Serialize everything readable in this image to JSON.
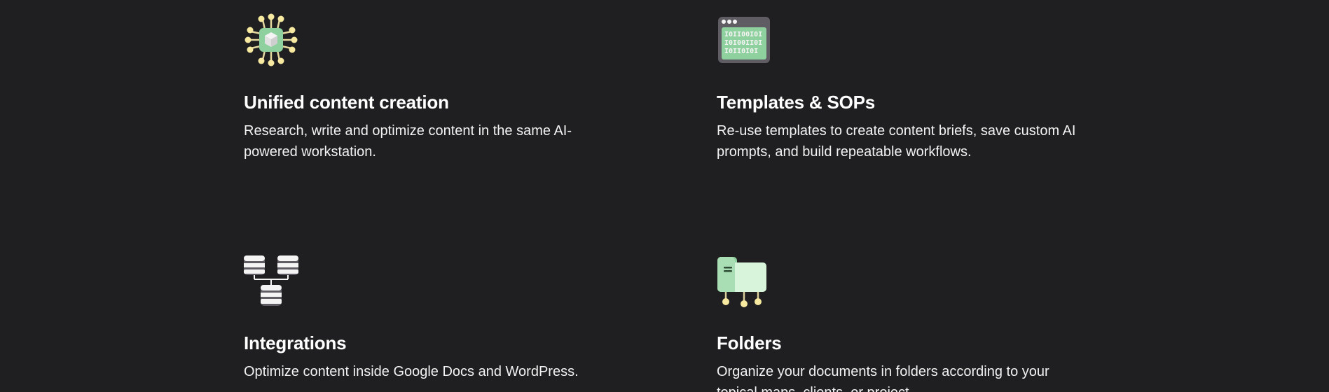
{
  "features": [
    {
      "icon": "ai-chip-icon",
      "title": "Unified content creation",
      "description": "Research, write and optimize content in the same AI-powered workstation."
    },
    {
      "icon": "binary-window-icon",
      "title": "Templates & SOPs",
      "description": "Re-use templates to create content briefs, save custom AI prompts, and build repeatable workflows."
    },
    {
      "icon": "database-network-icon",
      "title": "Integrations",
      "description": "Optimize content inside Google Docs and WordPress."
    },
    {
      "icon": "folder-network-icon",
      "title": "Folders",
      "description": "Organize your documents in folders according to your topical maps, clients, or project."
    }
  ],
  "colors": {
    "background": "#1f1f21",
    "accent_green": "#8fd19e",
    "accent_yellow": "#f7e9a0",
    "text": "#ffffff"
  }
}
